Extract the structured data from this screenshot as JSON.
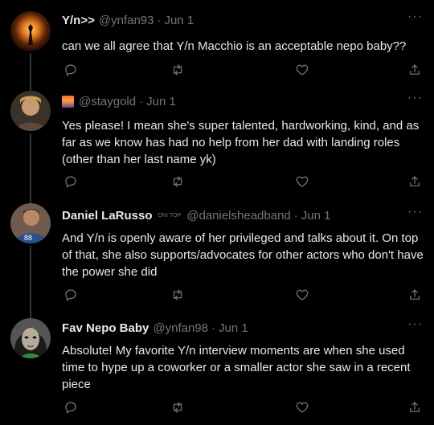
{
  "tweets": [
    {
      "name": "Y/n>>",
      "handle": "@ynfan93",
      "date": "Jun 1",
      "text": "can we all agree that Y/n Macchio is an acceptable nepo baby??"
    },
    {
      "name": "",
      "handle": "@staygold",
      "date": "Jun 1",
      "text": "Yes please! I mean she's super talented, hardworking, kind, and as far as we know has had no help from her dad with landing roles (other than her last name yk)"
    },
    {
      "name": "Daniel LaRusso",
      "handle": "@danielsheadband",
      "date": "Jun 1",
      "tools_left": "ON!",
      "tools_right": "TOP",
      "text": "And Y/n is openly aware of her privileged and talks about it. On top of that, she also supports/advocates for other actors who don't have the power she did"
    },
    {
      "name": "Fav Nepo Baby",
      "handle": "@ynfan98",
      "date": "Jun 1",
      "text": "Absolute! My favorite Y/n interview moments are when she used time to hype up a coworker or a smaller actor she saw in a recent piece"
    }
  ],
  "icons": {
    "more": "more-icon",
    "reply": "reply-icon",
    "retweet": "retweet-icon",
    "like": "like-icon",
    "share": "share-icon"
  },
  "colors": {
    "background": "#000000",
    "text": "#e7e9ea",
    "muted": "#71767b",
    "line": "#333639"
  }
}
